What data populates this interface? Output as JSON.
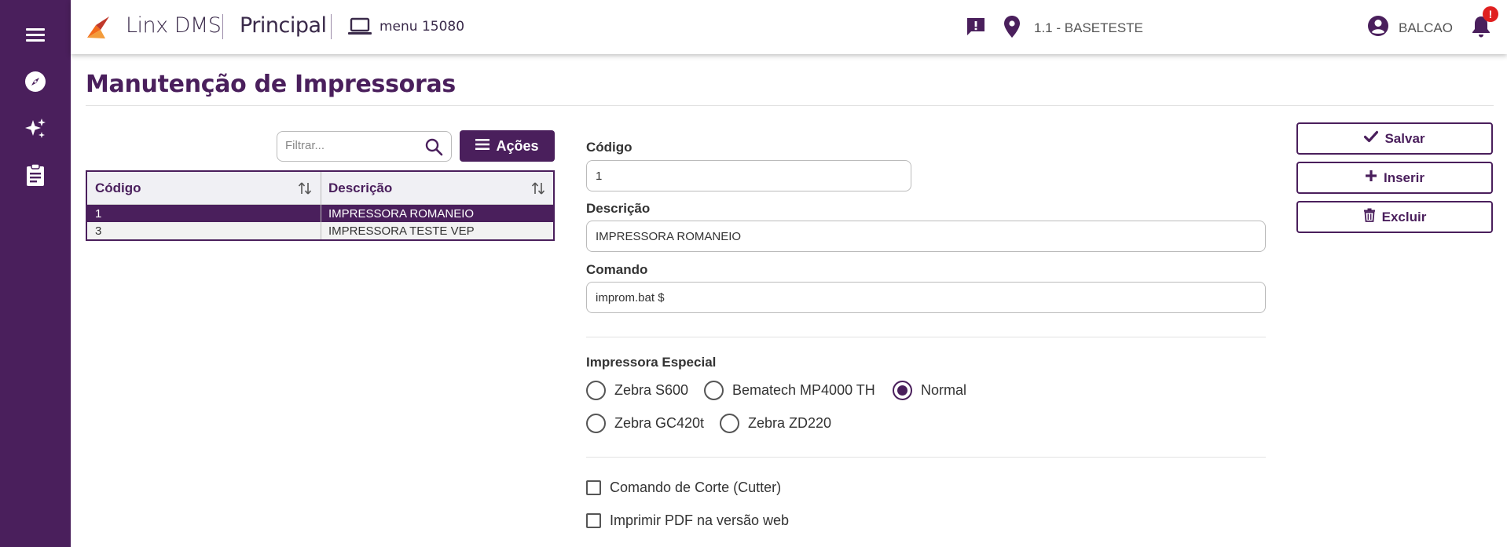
{
  "app": {
    "brand": "Linx DMS",
    "module": "Principal",
    "menu_label": "menu 15080",
    "branch": "1.1 - BASETESTE",
    "user": "BALCAO",
    "notification_badge": "!"
  },
  "sidebar": {
    "items": [
      {
        "icon": "hamburger-icon"
      },
      {
        "icon": "compass-icon"
      },
      {
        "icon": "sparkles-icon"
      },
      {
        "icon": "clipboard-icon"
      }
    ]
  },
  "page": {
    "title": "Manutenção de Impressoras"
  },
  "list": {
    "filter_placeholder": "Filtrar...",
    "actions_label": "Ações",
    "columns": [
      "Código",
      "Descrição"
    ],
    "rows": [
      {
        "codigo": "1",
        "descricao": "IMPRESSORA ROMANEIO",
        "selected": true
      },
      {
        "codigo": "3",
        "descricao": "IMPRESSORA TESTE VEP",
        "selected": false
      }
    ]
  },
  "form": {
    "codigo_label": "Código",
    "codigo_value": "1",
    "descricao_label": "Descrição",
    "descricao_value": "IMPRESSORA ROMANEIO",
    "comando_label": "Comando",
    "comando_value": "improm.bat $",
    "especial_label": "Impressora Especial",
    "especial_options": [
      "Zebra S600",
      "Bematech MP4000 TH",
      "Normal",
      "Zebra GC420t",
      "Zebra ZD220"
    ],
    "especial_selected": "Normal",
    "checkboxes": [
      {
        "label": "Comando de Corte (Cutter)",
        "checked": false
      },
      {
        "label": "Imprimir PDF na versão web",
        "checked": false
      }
    ]
  },
  "actions": {
    "save": "Salvar",
    "insert": "Inserir",
    "delete": "Excluir"
  },
  "colors": {
    "primary": "#4a1f5c",
    "badge": "#e02020",
    "logo_orange": "#f26a1b"
  }
}
